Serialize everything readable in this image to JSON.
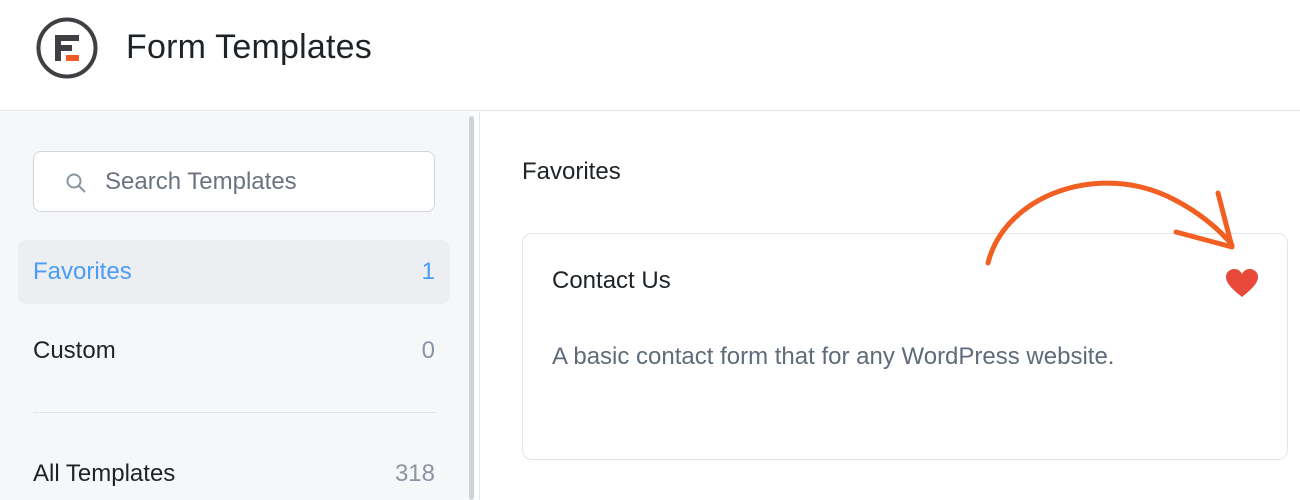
{
  "header": {
    "title": "Form Templates",
    "logo_icon": "formidable-logo-icon"
  },
  "colors": {
    "accent": "#4a9cf6",
    "logo_orange": "#f15a24",
    "heart": "#e8493b",
    "annotation_arrow": "#f16022"
  },
  "sidebar": {
    "search": {
      "placeholder": "Search Templates",
      "icon": "search-icon"
    },
    "items": [
      {
        "label": "Favorites",
        "count": "1",
        "active": true
      },
      {
        "label": "Custom",
        "count": "0",
        "active": false
      },
      {
        "label": "All Templates",
        "count": "318",
        "active": false
      }
    ]
  },
  "main": {
    "section_title": "Favorites",
    "cards": [
      {
        "title": "Contact Us",
        "description": "A basic contact form that for any WordPress website.",
        "favorite": true,
        "favorite_icon": "heart-icon"
      }
    ]
  }
}
